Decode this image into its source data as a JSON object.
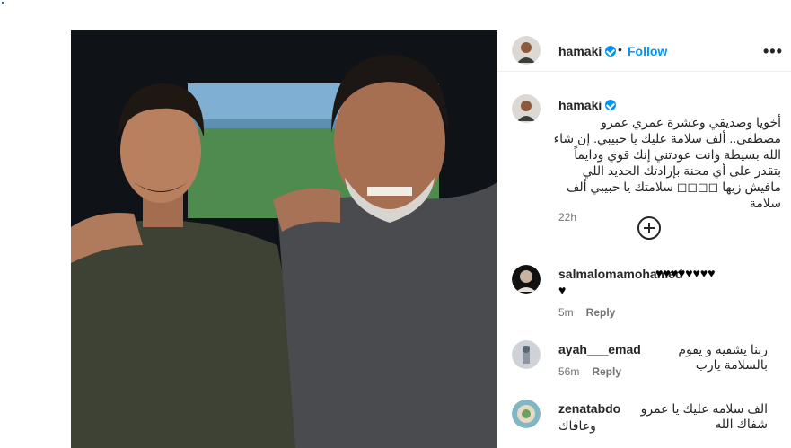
{
  "post": {
    "username": "hamaki",
    "dot": "•",
    "follow_label": "Follow",
    "more_label": "•••",
    "caption": "أخويا وصديقي وعشرة عمري عمرو مصطفى.. ألف سلامة عليك يا حبيبي. إن شاء الله بسيطة وانت عودتني إنك قوي ودايماً بتقدر على أي محنة بإرادتك الحديد اللي مافيش زيها ◻◻◻◻ سلامتك يا حبيبي ألف سلامة",
    "caption_time": "22h"
  },
  "comments": [
    {
      "username": "salmalomamohamed",
      "text_line1": "♥♥♥♥♥♥♥♥",
      "text_line2": "♥",
      "time": "5m",
      "reply": "Reply"
    },
    {
      "username": "ayah___emad",
      "text": "ربنا يشفيه و يقوم بالسلامة يارب",
      "time": "56m",
      "reply": "Reply"
    },
    {
      "username": "zenatabdo",
      "text_line1": "الف سلامه عليك يا عمرو شفاك الله",
      "text_line2": "وعافاك"
    }
  ],
  "colors": {
    "link": "#0095f6",
    "secondary": "#737373",
    "text": "#262626"
  },
  "icons": {
    "verified": "verified-badge-icon",
    "add": "add-circle-icon",
    "more": "more-options-icon"
  }
}
